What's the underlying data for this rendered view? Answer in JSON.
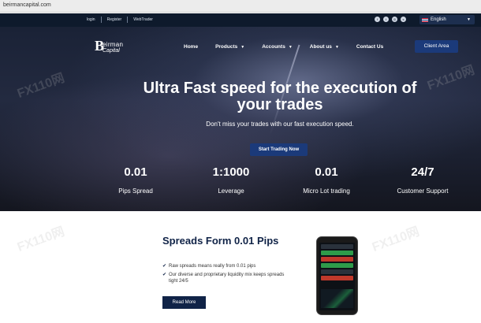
{
  "browser": {
    "url": "beirmancapital.com"
  },
  "topbar": {
    "links": [
      "login",
      "Register",
      "WebTrader"
    ],
    "social_icons": [
      "facebook-icon",
      "twitter-icon",
      "instagram-icon",
      "skype-icon"
    ],
    "language": "English"
  },
  "logo": {
    "mark": "B",
    "name": "eirman",
    "sub": "Capital"
  },
  "nav": {
    "items": [
      {
        "label": "Home",
        "dropdown": false
      },
      {
        "label": "Products",
        "dropdown": true
      },
      {
        "label": "Accounts",
        "dropdown": true
      },
      {
        "label": "About us",
        "dropdown": true
      },
      {
        "label": "Contact Us",
        "dropdown": false
      }
    ],
    "client_area": "Client Area"
  },
  "hero": {
    "headline": "Ultra Fast speed for the execution of your trades",
    "subhead": "Don't miss your trades with our fast execution speed.",
    "cta": "Start Trading Now"
  },
  "stats": [
    {
      "value": "0.01",
      "label": "Pips Spread"
    },
    {
      "value": "1:1000",
      "label": "Leverage"
    },
    {
      "value": "0.01",
      "label": "Micro Lot trading"
    },
    {
      "value": "24/7",
      "label": "Customer Support"
    }
  ],
  "spreads": {
    "title": "Spreads Form 0.01 Pips",
    "bullets": [
      "Raw spreads means really from 0.01 pips",
      "Our diverse and proprietary liquidity mix keeps spreads tight 24/5"
    ],
    "button": "Read More"
  },
  "watermark": "FX110网",
  "colors": {
    "brand": "#102347",
    "button": "#1b3a7a",
    "topbar": "#0e1a2c"
  }
}
